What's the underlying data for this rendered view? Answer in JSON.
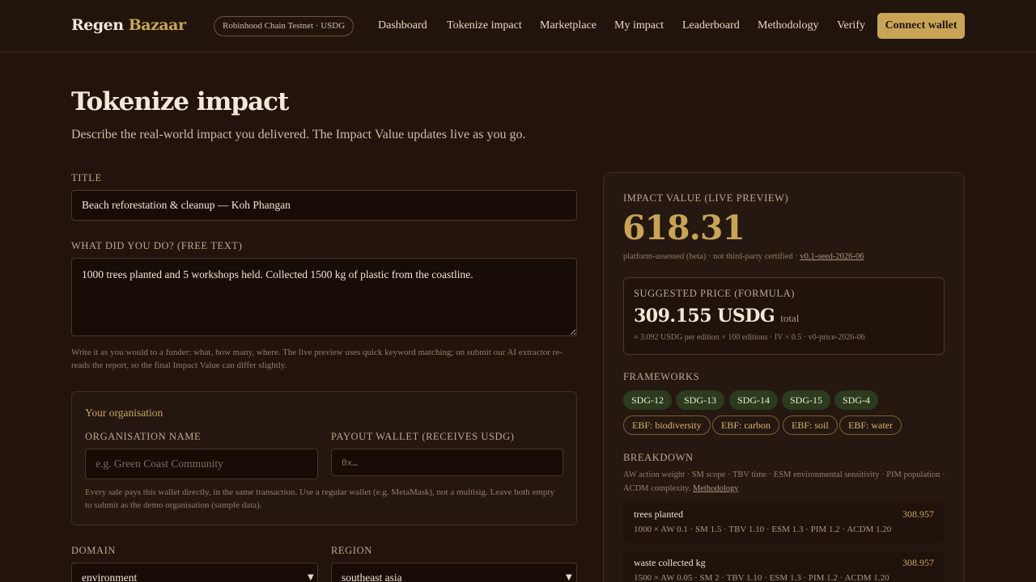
{
  "header": {
    "logo_part1": "Regen",
    "logo_part2": "Bazaar",
    "network": "Robinhood Chain Testnet · USDG",
    "nav": [
      "Dashboard",
      "Tokenize impact",
      "Marketplace",
      "My impact",
      "Leaderboard",
      "Methodology",
      "Verify"
    ],
    "connect_label": "Connect wallet"
  },
  "page": {
    "title": "Tokenize impact",
    "subtitle": "Describe the real-world impact you delivered. The Impact Value updates live as you go."
  },
  "form": {
    "title_label": "TITLE",
    "title_value": "Beach reforestation & cleanup — Koh Phangan",
    "desc_label": "WHAT DID YOU DO? (FREE TEXT)",
    "desc_value": "1000 trees planted and 5 workshops held. Collected 1500 kg of plastic from the coastline.",
    "desc_hint": "Write it as you would to a funder: what, how many, where. The live preview uses quick keyword matching; on submit our AI extractor re-reads the report, so the final Impact Value can differ slightly.",
    "org": {
      "title": "Your organisation",
      "name_label": "ORGANISATION NAME",
      "name_placeholder": "e.g. Green Coast Community",
      "wallet_label": "PAYOUT WALLET (RECEIVES USDG)",
      "wallet_placeholder": "0x…",
      "hint": "Every sale pays this wallet directly, in the same transaction. Use a regular wallet (e.g. MetaMask), not a multisig. Leave both empty to submit as the demo organisation (sample data)."
    },
    "domain_label": "DOMAIN",
    "domain_value": "environment",
    "region_label": "REGION",
    "region_value": "southeast asia"
  },
  "preview": {
    "label": "IMPACT VALUE (LIVE PREVIEW)",
    "value": "618.31",
    "note": "platform-assessed (beta) · not third-party certified · ",
    "version": "v0.1-seed-2026-06",
    "price_label": "SUGGESTED PRICE (FORMULA)",
    "price_value": "309.155 USDG",
    "price_unit": "total",
    "price_note": "≈ 3.092 USDG per edition × 100 editions · IV × 0.5 · v0-price-2026-06",
    "frameworks_label": "FRAMEWORKS",
    "sdg_chips": [
      "SDG-12",
      "SDG-13",
      "SDG-14",
      "SDG-15",
      "SDG-4"
    ],
    "ebf_chips": [
      "EBF: biodiversity",
      "EBF: carbon",
      "EBF: soil",
      "EBF: water"
    ],
    "breakdown_label": "BREAKDOWN",
    "breakdown_desc": "AW action weight · SM scope · TBV time · ESM environmental sensitivity · PIM population · ACDM complexity. ",
    "breakdown_link": "Methodology",
    "rows": [
      {
        "name": "trees planted",
        "value": "308.957",
        "formula": "1000 × AW 0.1 · SM 1.5 · TBV 1.10 · ESM 1.3 · PIM 1.2 · ACDM 1.20"
      },
      {
        "name": "waste collected kg",
        "value": "308.957",
        "formula": "1500 × AW 0.05 · SM 2 · TBV 1.10 · ESM 1.3 · PIM 1.2 · ACDM 1.20"
      }
    ]
  }
}
